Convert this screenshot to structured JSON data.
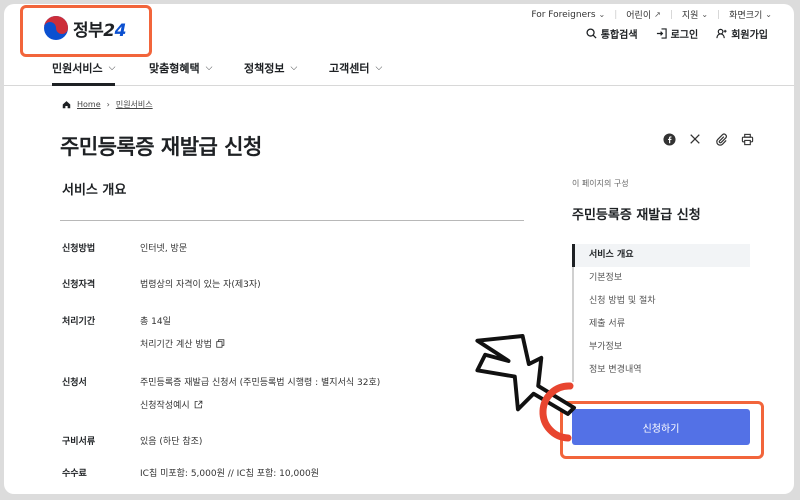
{
  "header": {
    "logo_text_main": "정부",
    "logo_text_num2": "2",
    "logo_text_num4": "4",
    "utility": [
      {
        "label": "For Foreigners",
        "suffix": "⌄"
      },
      {
        "label": "어린이",
        "suffix": "↗"
      },
      {
        "label": "지원",
        "suffix": "⌄"
      },
      {
        "label": "화면크기",
        "suffix": "⌄"
      }
    ],
    "account": {
      "search": "통합검색",
      "login": "로그인",
      "signup": "회원가입"
    },
    "gnb": [
      {
        "label": "민원서비스"
      },
      {
        "label": "맞춤형혜택"
      },
      {
        "label": "정책정보"
      },
      {
        "label": "고객센터"
      }
    ]
  },
  "breadcrumb": {
    "home": "Home",
    "current": "민원서비스"
  },
  "page": {
    "title": "주민등록증 재발급 신청",
    "section_title": "서비스 개요"
  },
  "rows": [
    {
      "label": "신청방법",
      "value": "인터넷, 방문"
    },
    {
      "label": "신청자격",
      "value": "법령상의 자격이 있는 자(제3자)"
    },
    {
      "label": "처리기간",
      "value": "총 14일",
      "extra": "처리기간 계산 방법"
    },
    {
      "label": "신청서",
      "value": "주민등록증 재발급 신청서 (주민등록법 시행령 : 별지서식 32호)",
      "extra": "신청작성예시"
    },
    {
      "label": "구비서류",
      "value": "있음 (하단 참조)"
    },
    {
      "label": "수수료",
      "value": "IC칩 미포함: 5,000원 // IC칩 포함: 10,000원"
    }
  ],
  "toc": {
    "caption": "이 페이지의 구성",
    "title": "주민등록증 재발급 신청",
    "items": [
      "서비스 개요",
      "기본정보",
      "신청 방법 및 절차",
      "제출 서류",
      "부가정보",
      "정보 변경내역"
    ]
  },
  "apply_label": "신청하기",
  "colors": {
    "accent": "#5371e6",
    "highlight": "#f2653b"
  }
}
